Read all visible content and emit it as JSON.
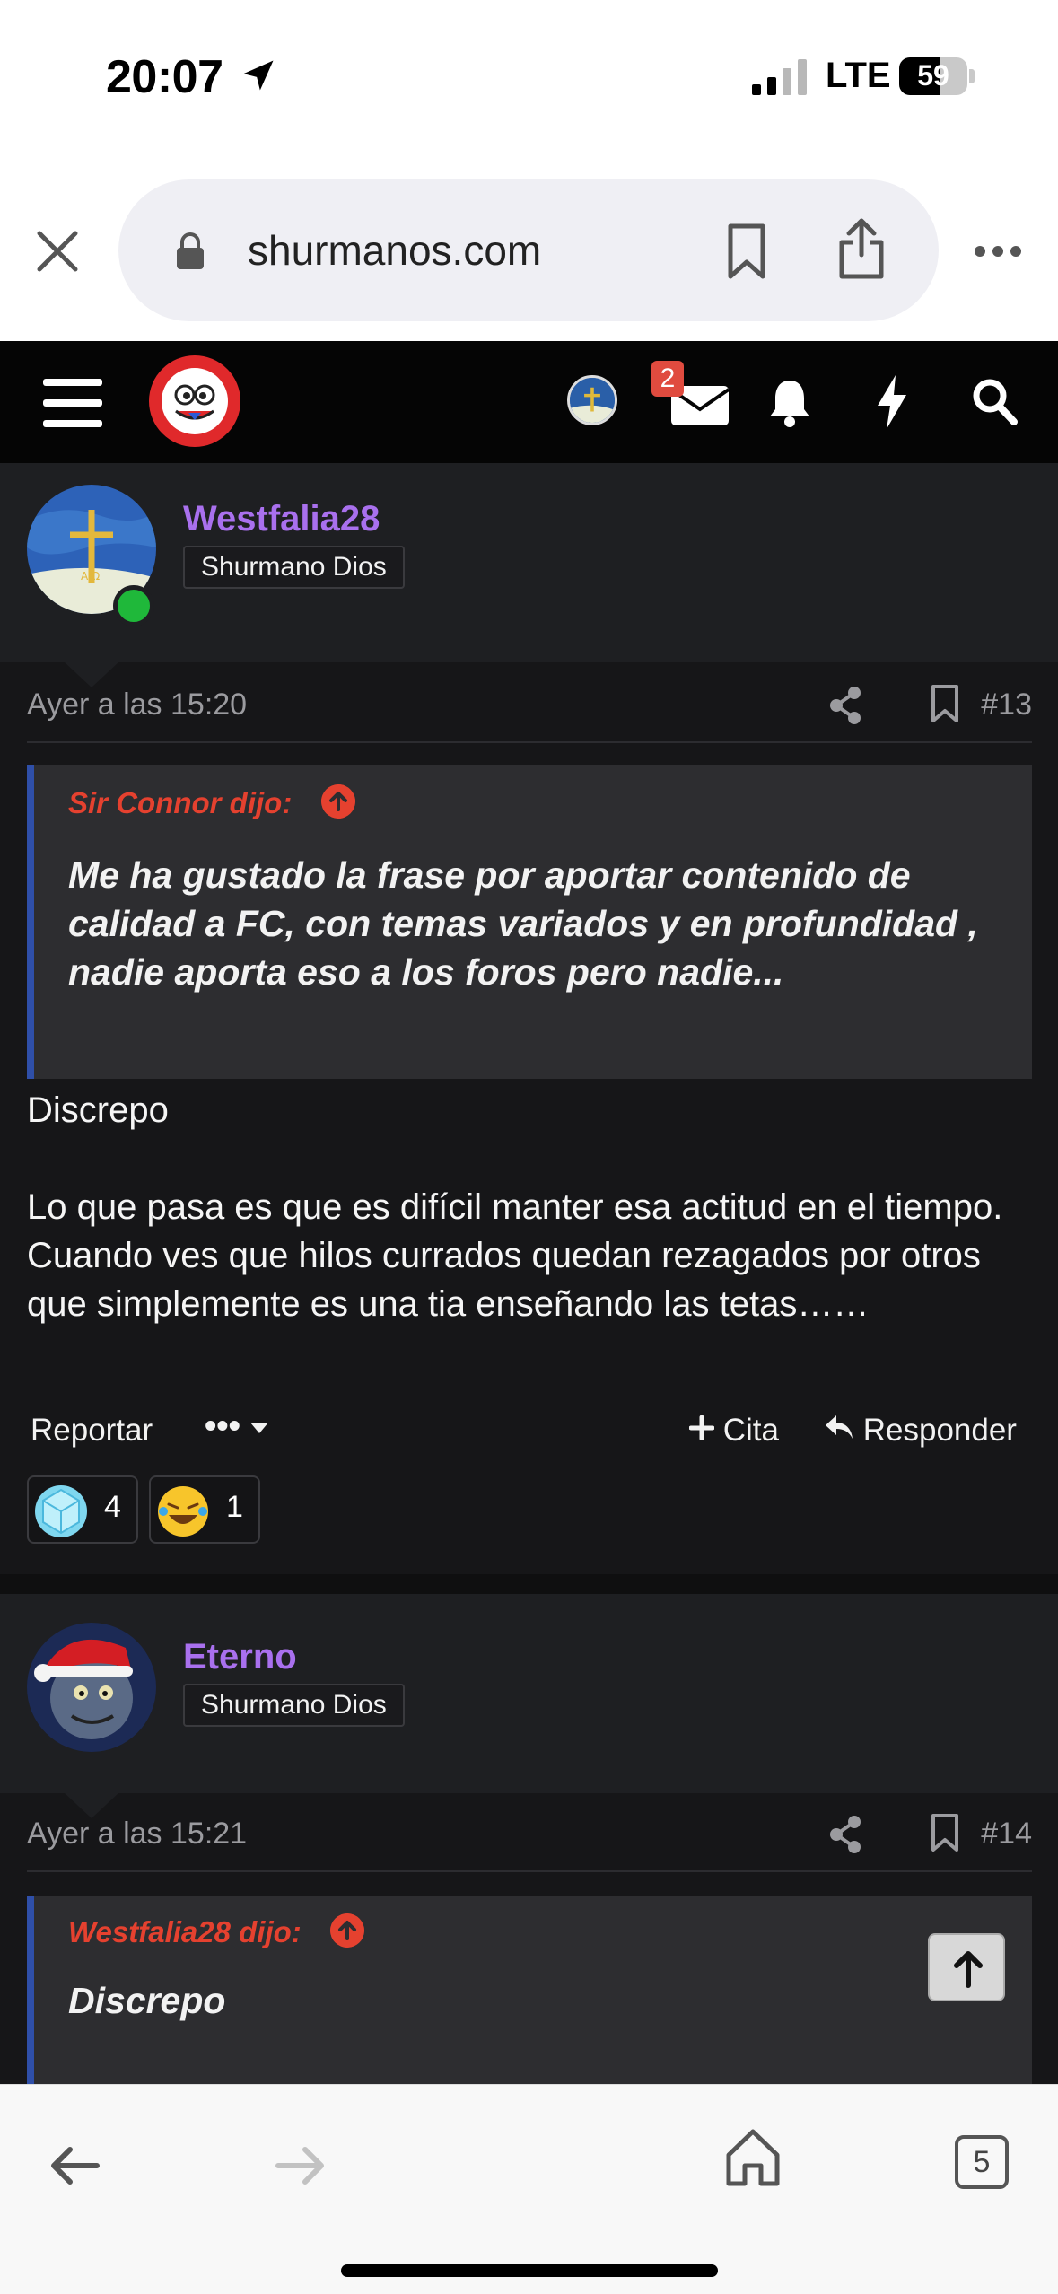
{
  "status_bar": {
    "time": "20:07",
    "network": "LTE",
    "battery": "59",
    "battery_level": 0.59
  },
  "browser": {
    "url": "shurmanos.com",
    "tab_count": "5"
  },
  "header": {
    "notification_count": "2"
  },
  "posts": [
    {
      "username": "Westfalia28",
      "user_title": "Shurmano Dios",
      "online": true,
      "date": "Ayer a las 15:20",
      "post_number": "#13",
      "quote": {
        "author": "Sir Connor dijo:",
        "text": "Me ha gustado la frase por aportar contenido de calidad a FC, con temas variados y en profundidad , nadie aporta eso a los foros pero nadie..."
      },
      "body_lines": [
        "Discrepo",
        "",
        "Lo que pasa es que es difícil manter esa actitud en el tiempo. Cuando ves que hilos currados quedan rezagados por otros que simplemente es una tia enseñando las tetas……"
      ],
      "actions": {
        "report": "Reportar",
        "more": "•••",
        "quote": "Cita",
        "reply": "Responder"
      },
      "reactions": [
        {
          "icon": "diamond-icon",
          "count": "4"
        },
        {
          "icon": "laughing-emoji-icon",
          "count": "1"
        }
      ]
    },
    {
      "username": "Eterno",
      "user_title": "Shurmano Dios",
      "online": false,
      "date": "Ayer a las 15:21",
      "post_number": "#14",
      "quote": {
        "author": "Westfalia28 dijo:",
        "text": "Discrepo"
      }
    }
  ],
  "colors": {
    "username": "#a970ee",
    "quote_author": "#e5412f",
    "quote_border": "#2f4fa8",
    "background": "#161618"
  }
}
